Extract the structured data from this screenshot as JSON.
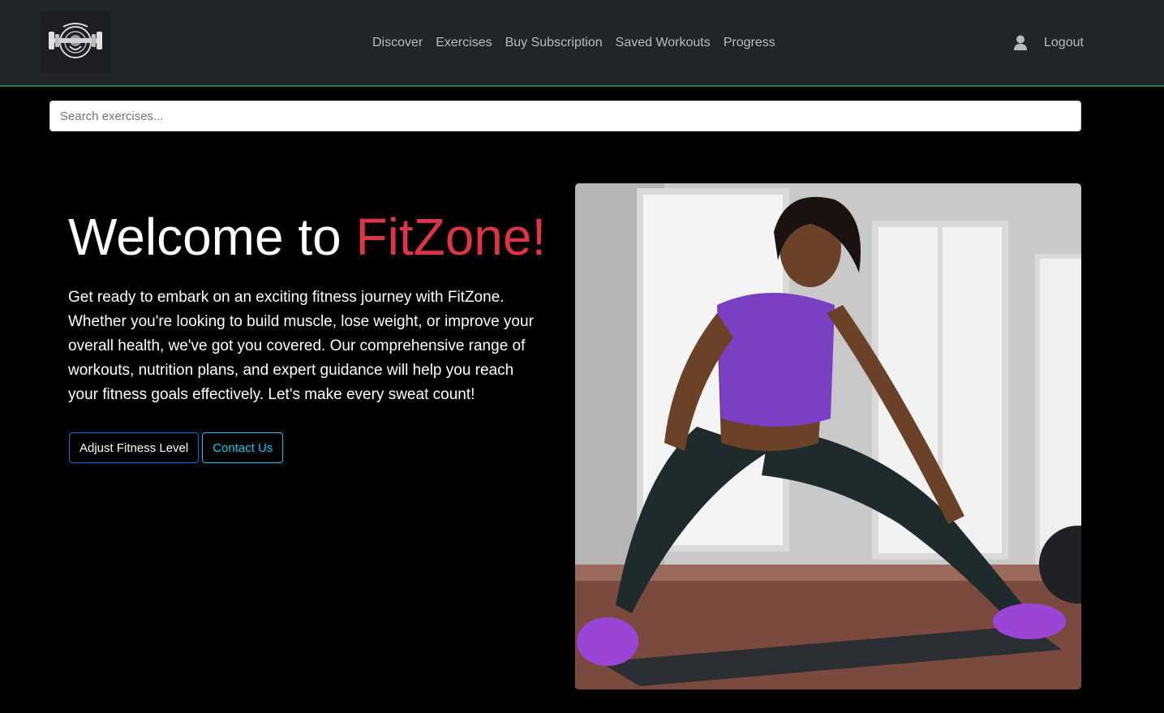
{
  "nav": {
    "logo_icon": "gym-emblem-logo",
    "links": [
      "Discover",
      "Exercises",
      "Buy Subscription",
      "Saved Workouts",
      "Progress"
    ],
    "user_icon": "user-icon",
    "logout_label": "Logout"
  },
  "search": {
    "placeholder": "Search exercises..."
  },
  "hero": {
    "title_prefix": "Welcome to ",
    "title_brand": "FitZone!",
    "description": "Get ready to embark on an exciting fitness journey with FitZone. Whether you're looking to build muscle, lose weight, or improve your overall health, we've got you covered. Our comprehensive range of workouts, nutrition plans, and expert guidance will help you reach your fitness goals effectively. Let's make every sweat count!",
    "buttons": {
      "adjust_fitness_level": "Adjust Fitness Level",
      "contact_us": "Contact Us"
    },
    "image": "woman-stretching-lunge-photo"
  },
  "colors": {
    "navbar_bg": "#212529",
    "navbar_border": "#198754",
    "page_bg": "#000000",
    "brand_red": "#dc3545",
    "primary_blue": "#0d6efd",
    "info_cyan": "#0dcaf0",
    "top_purple": "#7b3fc4"
  }
}
